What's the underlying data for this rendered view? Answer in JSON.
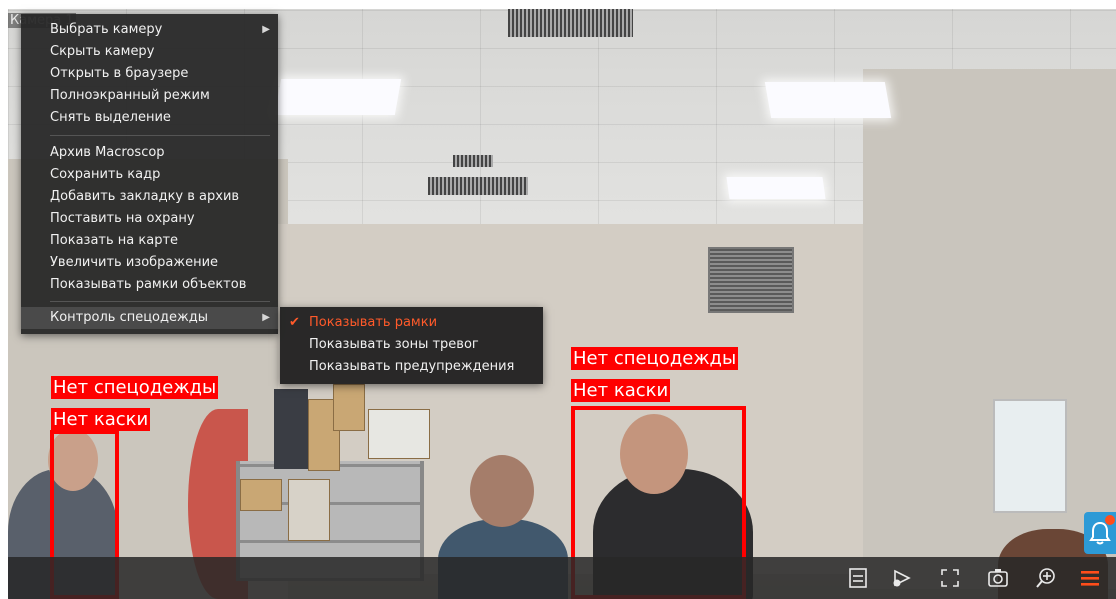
{
  "camera_title": "Камера 1",
  "context_menu": {
    "items": [
      {
        "label": "Выбрать камеру",
        "submenu": true
      },
      {
        "label": "Скрыть камеру"
      },
      {
        "label": "Открыть в браузере"
      },
      {
        "label": "Полноэкранный режим"
      },
      {
        "label": "Снять выделение"
      },
      {
        "label": "Архив Macroscop"
      },
      {
        "label": "Сохранить кадр"
      },
      {
        "label": "Добавить закладку в архив"
      },
      {
        "label": "Поставить на охрану"
      },
      {
        "label": "Показать на карте"
      },
      {
        "label": "Увеличить изображение"
      },
      {
        "label": "Показывать рамки объектов"
      },
      {
        "label": "Контроль спецодежды",
        "submenu": true,
        "highlighted": true
      }
    ]
  },
  "submenu": {
    "items": [
      {
        "label": "Показывать рамки",
        "checked": true
      },
      {
        "label": "Показывать зоны тревог"
      },
      {
        "label": "Показывать предупреждения"
      }
    ]
  },
  "detections": [
    {
      "labels": [
        "Нет спецодежды",
        "Нет каски"
      ]
    },
    {
      "labels": [
        "Нет спецодежды",
        "Нет каски"
      ]
    }
  ],
  "toolbar": {
    "icons": [
      "list-icon",
      "camera-settings-icon",
      "fullscreen-icon",
      "snapshot-icon",
      "zoom-in-icon",
      "menu-icon"
    ]
  },
  "colors": {
    "alarm_red": "#ff0000",
    "accent_orange": "#ff5a2a",
    "notify_blue": "#2d9ad6"
  }
}
